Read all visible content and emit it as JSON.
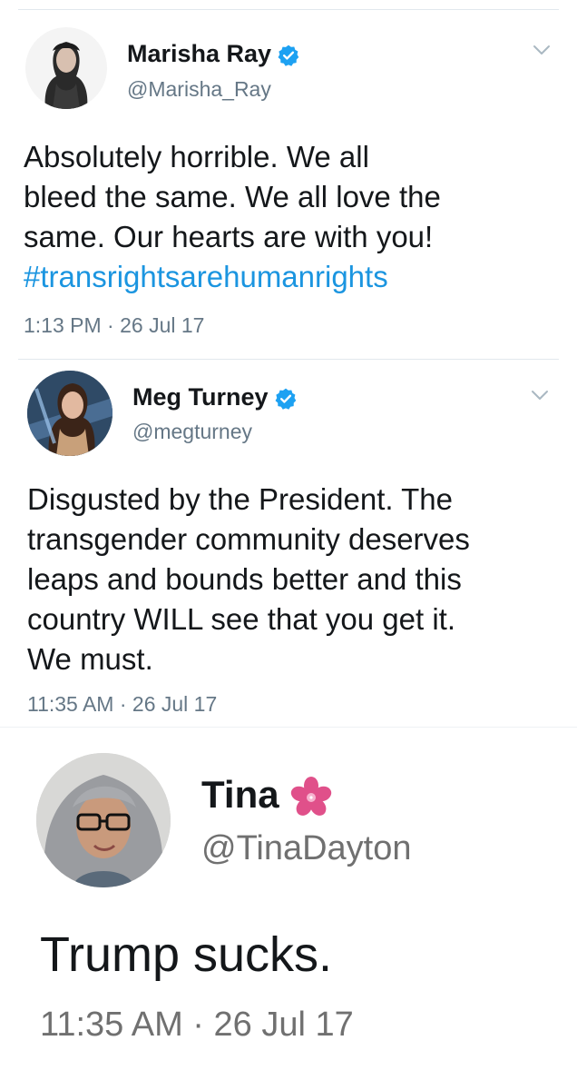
{
  "tweets": [
    {
      "name": "Marisha Ray",
      "handle": "@Marisha_Ray",
      "verified": true,
      "lines": [
        "Absolutely horrible. We all",
        "bleed the same. We all love the",
        "same. Our hearts are with you!"
      ],
      "hashtag": "#transrightsarehumanrights",
      "time": "1:13 PM · 26 Jul 17"
    },
    {
      "name": "Meg Turney",
      "handle": "@megturney",
      "verified": true,
      "lines": [
        "Disgusted by the President. The",
        "transgender community deserves",
        "leaps and bounds better and this",
        "country WILL see that you get it.",
        "We must."
      ],
      "time": "11:35 AM · 26 Jul 17"
    },
    {
      "name": "Tina",
      "handle": "@TinaDayton",
      "emoji": "cherry-blossom-icon",
      "lines": [
        "Trump sucks."
      ],
      "time": "11:35 AM · 26 Jul 17"
    }
  ],
  "colors": {
    "link": "#1b95e0",
    "verified": "#1da1f2",
    "muted": "#657786",
    "flower": "#e0508a"
  }
}
